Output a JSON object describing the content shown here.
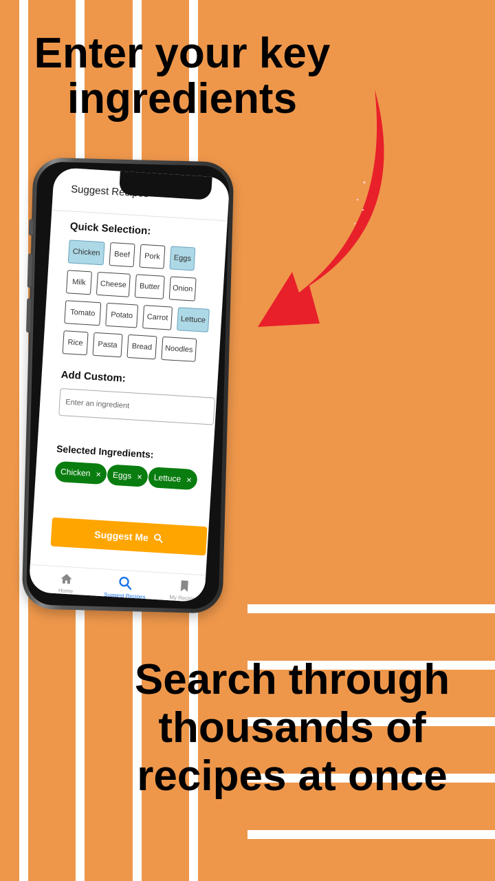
{
  "banner": {
    "top_line1": "Enter your key",
    "top_line2": "ingredients",
    "bottom_line1": "Search through",
    "bottom_line2": "thousands of",
    "bottom_line3": "recipes at once"
  },
  "colors": {
    "background": "#EE974B",
    "arrow": "#E8202A",
    "selected_chip": "#ADD8E6",
    "selected_tag": "#0A7D10",
    "suggest_button": "#FFA500",
    "active_nav": "#1A73E8"
  },
  "app": {
    "title": "Suggest Recipes",
    "quick_selection_label": "Quick Selection:",
    "chips": [
      {
        "label": "Chicken",
        "selected": true
      },
      {
        "label": "Beef",
        "selected": false
      },
      {
        "label": "Pork",
        "selected": false
      },
      {
        "label": "Eggs",
        "selected": true
      },
      {
        "label": "Milk",
        "selected": false
      },
      {
        "label": "Cheese",
        "selected": false
      },
      {
        "label": "Butter",
        "selected": false
      },
      {
        "label": "Onion",
        "selected": false
      },
      {
        "label": "Tomato",
        "selected": false
      },
      {
        "label": "Potato",
        "selected": false
      },
      {
        "label": "Carrot",
        "selected": false
      },
      {
        "label": "Lettuce",
        "selected": true
      },
      {
        "label": "Rice",
        "selected": false
      },
      {
        "label": "Pasta",
        "selected": false
      },
      {
        "label": "Bread",
        "selected": false
      },
      {
        "label": "Noodles",
        "selected": false
      }
    ],
    "add_custom_label": "Add Custom:",
    "custom_placeholder": "Enter an ingredient",
    "selected_label": "Selected Ingredients:",
    "selected": [
      "Chicken",
      "Eggs",
      "Lettuce"
    ],
    "remove_glyph": "×",
    "suggest_label": "Suggest Me",
    "nav": [
      {
        "label": "Home",
        "icon": "home-icon",
        "active": false
      },
      {
        "label": "Suggest Recipes",
        "icon": "search-icon",
        "active": true
      },
      {
        "label": "My Recipes",
        "icon": "bookmark-icon",
        "active": false
      }
    ]
  }
}
